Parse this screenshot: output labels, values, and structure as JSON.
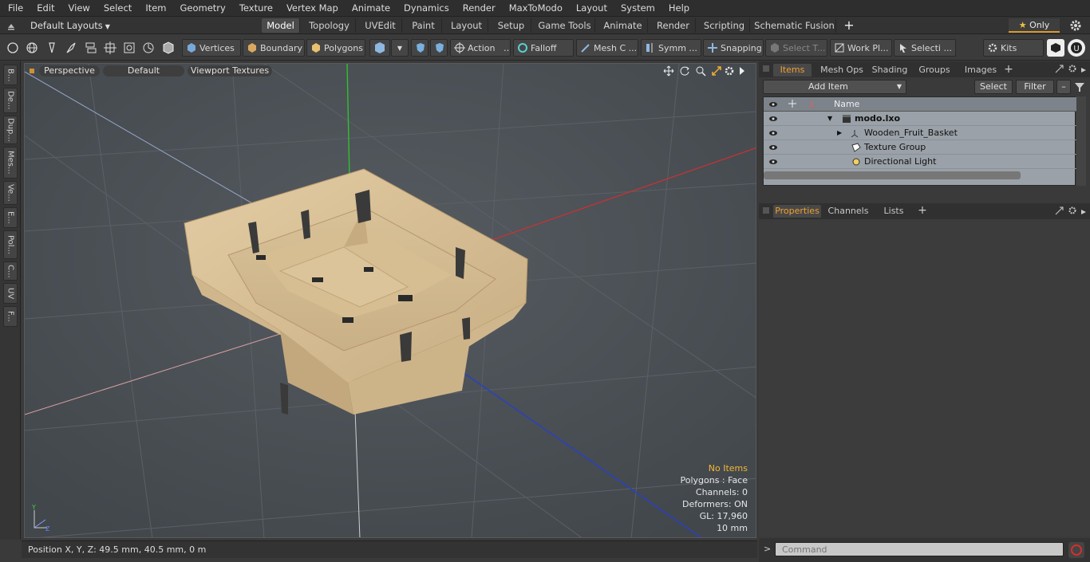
{
  "menu": [
    "File",
    "Edit",
    "View",
    "Select",
    "Item",
    "Geometry",
    "Texture",
    "Vertex Map",
    "Animate",
    "Dynamics",
    "Render",
    "MaxToModo",
    "Layout",
    "System",
    "Help"
  ],
  "layouts": {
    "label": "Default Layouts"
  },
  "tabs": [
    "Model",
    "Topology",
    "UVEdit",
    "Paint",
    "Layout",
    "Setup",
    "Game Tools",
    "Animate",
    "Render",
    "Scripting",
    "Schematic Fusion"
  ],
  "only_label": "Only",
  "toolbar": {
    "vertices": "Vertices",
    "boundary": "Boundary",
    "polygons": "Polygons",
    "action": "Action",
    "falloff": "Falloff",
    "mesh": "Mesh C ...",
    "symm": "Symm ...",
    "snapping": "Snapping",
    "select_t": "Select T...",
    "workpl": "Work Pl...",
    "selecti": "Selecti ...",
    "kits": "Kits"
  },
  "leftstrip": [
    "B...",
    "De...",
    "Dup...",
    "Mes...",
    "Ve...",
    "E...",
    "Pol...",
    "C...",
    "UV",
    "F..."
  ],
  "viewport": {
    "view_mode": "Perspective",
    "shading": "Default",
    "textures": "Viewport Textures",
    "info": {
      "no_items": "No Items",
      "polygons": "Polygons : Face",
      "channels": "Channels: 0",
      "deformers": "Deformers: ON",
      "gl": "GL: 17,960",
      "grid": "10 mm"
    }
  },
  "status": {
    "position": "Position X, Y, Z:   49.5 mm, 40.5 mm, 0 m"
  },
  "panel_top": {
    "tabs": [
      "Items",
      "Mesh Ops",
      "Shading",
      "Groups",
      "Images"
    ],
    "add_item": "Add Item",
    "select": "Select",
    "filter": "Filter",
    "col_name": "Name",
    "rows": [
      {
        "label": "modo.lxo"
      },
      {
        "label": "Wooden_Fruit_Basket"
      },
      {
        "label": "Texture Group"
      },
      {
        "label": "Directional Light"
      }
    ]
  },
  "panel_bottom": {
    "tabs": [
      "Properties",
      "Channels",
      "Lists"
    ]
  },
  "command": {
    "placeholder": "Command"
  }
}
